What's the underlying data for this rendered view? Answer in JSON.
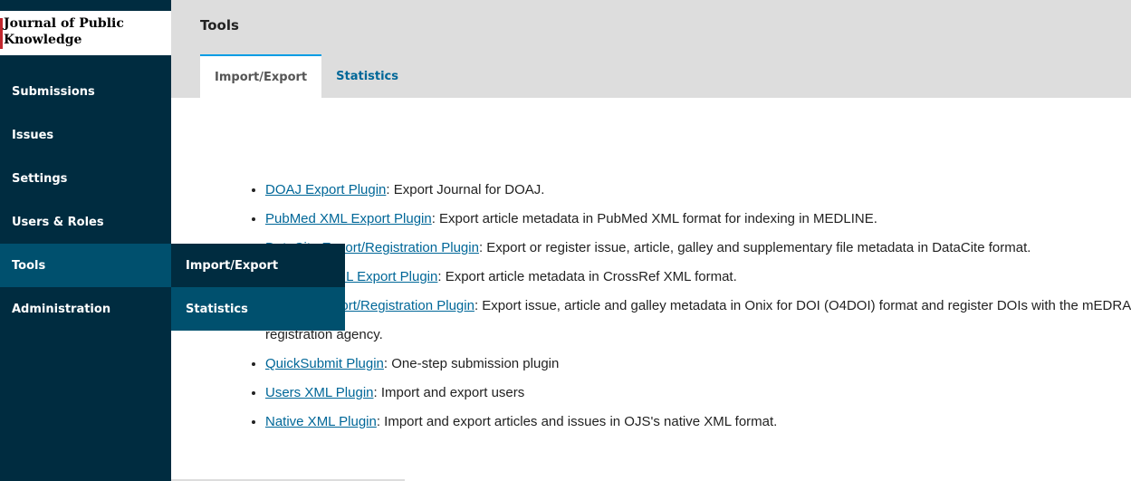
{
  "sidebar": {
    "logo_text": "Journal of Public Knowledge",
    "items": [
      {
        "label": "Submissions"
      },
      {
        "label": "Issues"
      },
      {
        "label": "Settings"
      },
      {
        "label": "Users & Roles"
      },
      {
        "label": "Tools",
        "active": true
      },
      {
        "label": "Administration"
      }
    ],
    "flyout": [
      {
        "label": "Import/Export"
      },
      {
        "label": "Statistics"
      }
    ]
  },
  "header": {
    "title": "Tools",
    "tabs": [
      {
        "label": "Import/Export",
        "active": true
      },
      {
        "label": "Statistics",
        "active": false
      }
    ]
  },
  "plugins": [
    {
      "name": "DOAJ Export Plugin",
      "description": ": Export Journal for DOAJ."
    },
    {
      "name": "PubMed XML Export Plugin",
      "description": ": Export article metadata in PubMed XML format for indexing in MEDLINE."
    },
    {
      "name": "DataCite Export/Registration Plugin",
      "description": ": Export or register issue, article, galley and supplementary file metadata in DataCite format."
    },
    {
      "name": "CrossRef XML Export Plugin",
      "description": ": Export article metadata in CrossRef XML format."
    },
    {
      "name": "mEDRA Export/Registration Plugin",
      "description": ": Export issue, article and galley metadata in Onix for DOI (O4DOI) format and register DOIs with the mEDRA registration agency."
    },
    {
      "name": "QuickSubmit Plugin",
      "description": ": One-step submission plugin"
    },
    {
      "name": "Users XML Plugin",
      "description": ": Import and export users"
    },
    {
      "name": "Native XML Plugin",
      "description": ": Import and export articles and issues in OJS's native XML format."
    }
  ],
  "colors": {
    "sidebar_bg": "#002c40",
    "active_bg": "#00506e",
    "link": "#006798",
    "tab_accent": "#009de5"
  }
}
